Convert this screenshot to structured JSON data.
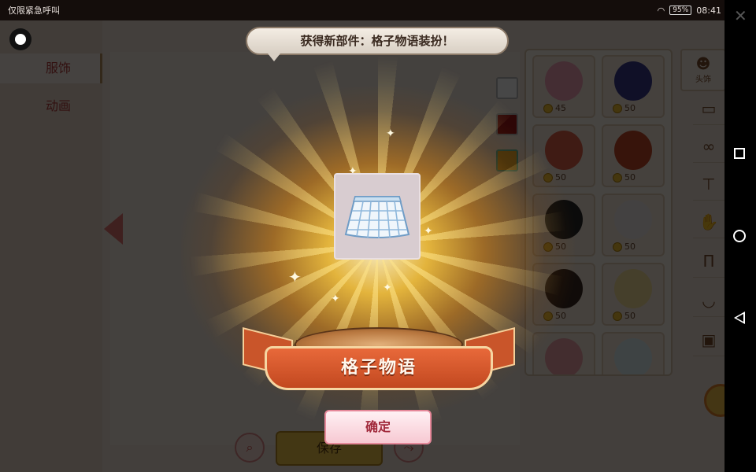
{
  "status_bar": {
    "carrier": "仅限紧急呼叫",
    "battery": "95%",
    "time": "08:41"
  },
  "left_tabs": [
    {
      "label": "服饰"
    },
    {
      "label": "动画"
    }
  ],
  "color_swatches": [
    "#ffffff",
    "#a01818",
    "#e0a82a"
  ],
  "items_grid": [
    {
      "price": "45",
      "color": "#f5a0b8"
    },
    {
      "price": "50",
      "color": "#3a3a8c"
    },
    {
      "price": "50",
      "color": "#e0604a"
    },
    {
      "price": "50",
      "color": "#c44a2a"
    },
    {
      "price": "50",
      "color": "#2a2a2a"
    },
    {
      "price": "50",
      "color": "#f0eaea"
    },
    {
      "price": "50",
      "color": "#3a2a20"
    },
    {
      "price": "50",
      "color": "#f6e09a"
    },
    {
      "price": "",
      "color": "#f0a0a8"
    },
    {
      "price": "",
      "color": "#dff0f4"
    }
  ],
  "category_first_label": "头饰",
  "save_button": "保存",
  "toast": "获得新部件：格子物语装扮！",
  "reward": {
    "item_name": "格子物语"
  },
  "confirm_button": "确定"
}
